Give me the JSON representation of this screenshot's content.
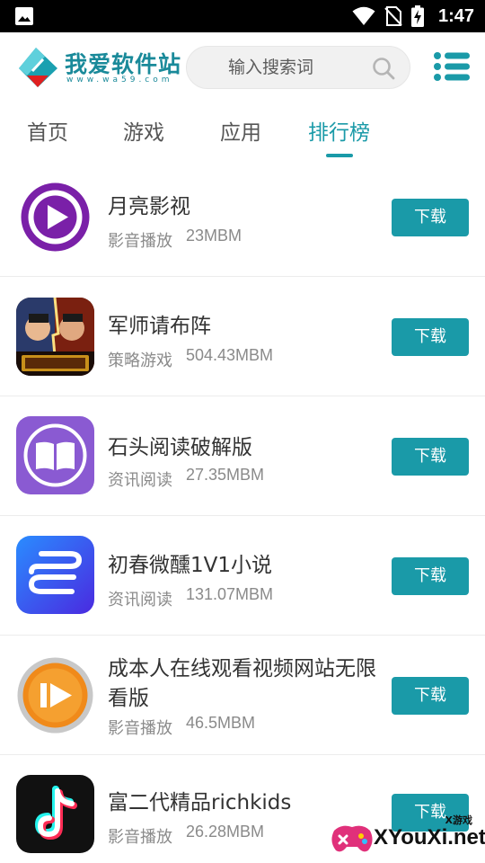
{
  "status_bar": {
    "time": "1:47",
    "icons": [
      "image-icon",
      "wifi-icon",
      "no-sim-icon",
      "battery-charging-icon"
    ]
  },
  "header": {
    "logo_title": "我爱软件站",
    "logo_subtitle": "www.wa59.com",
    "search_placeholder": "输入搜索词"
  },
  "tabs": [
    {
      "label": "首页",
      "active": false
    },
    {
      "label": "游戏",
      "active": false
    },
    {
      "label": "应用",
      "active": false
    },
    {
      "label": "排行榜",
      "active": true
    }
  ],
  "apps": [
    {
      "name": "月亮影视",
      "category": "影音播放",
      "size": "23MBM",
      "button": "下载",
      "icon": "play-circle-icon"
    },
    {
      "name": "军师请布阵",
      "category": "策略游戏",
      "size": "504.43MBM",
      "button": "下载",
      "icon": "game-cover-icon"
    },
    {
      "name": "石头阅读破解版",
      "category": "资讯阅读",
      "size": "27.35MBM",
      "button": "下载",
      "icon": "book-icon"
    },
    {
      "name": "初春微醺1V1小说",
      "category": "资讯阅读",
      "size": "131.07MBM",
      "button": "下载",
      "icon": "wave-logo-icon"
    },
    {
      "name": "成本人在线观看视频网站无限看版",
      "category": "影音播放",
      "size": "46.5MBM",
      "button": "下载",
      "icon": "fast-forward-icon"
    },
    {
      "name": "富二代精品richkids",
      "category": "影音播放",
      "size": "26.28MBM",
      "button": "下载",
      "icon": "tiktok-note-icon"
    }
  ],
  "watermark": {
    "small": "X游戏",
    "big": "XYouXi.net"
  },
  "colors": {
    "accent": "#1a9aa8",
    "status_bar": "#000000",
    "muted_text": "#8a8a8a"
  }
}
